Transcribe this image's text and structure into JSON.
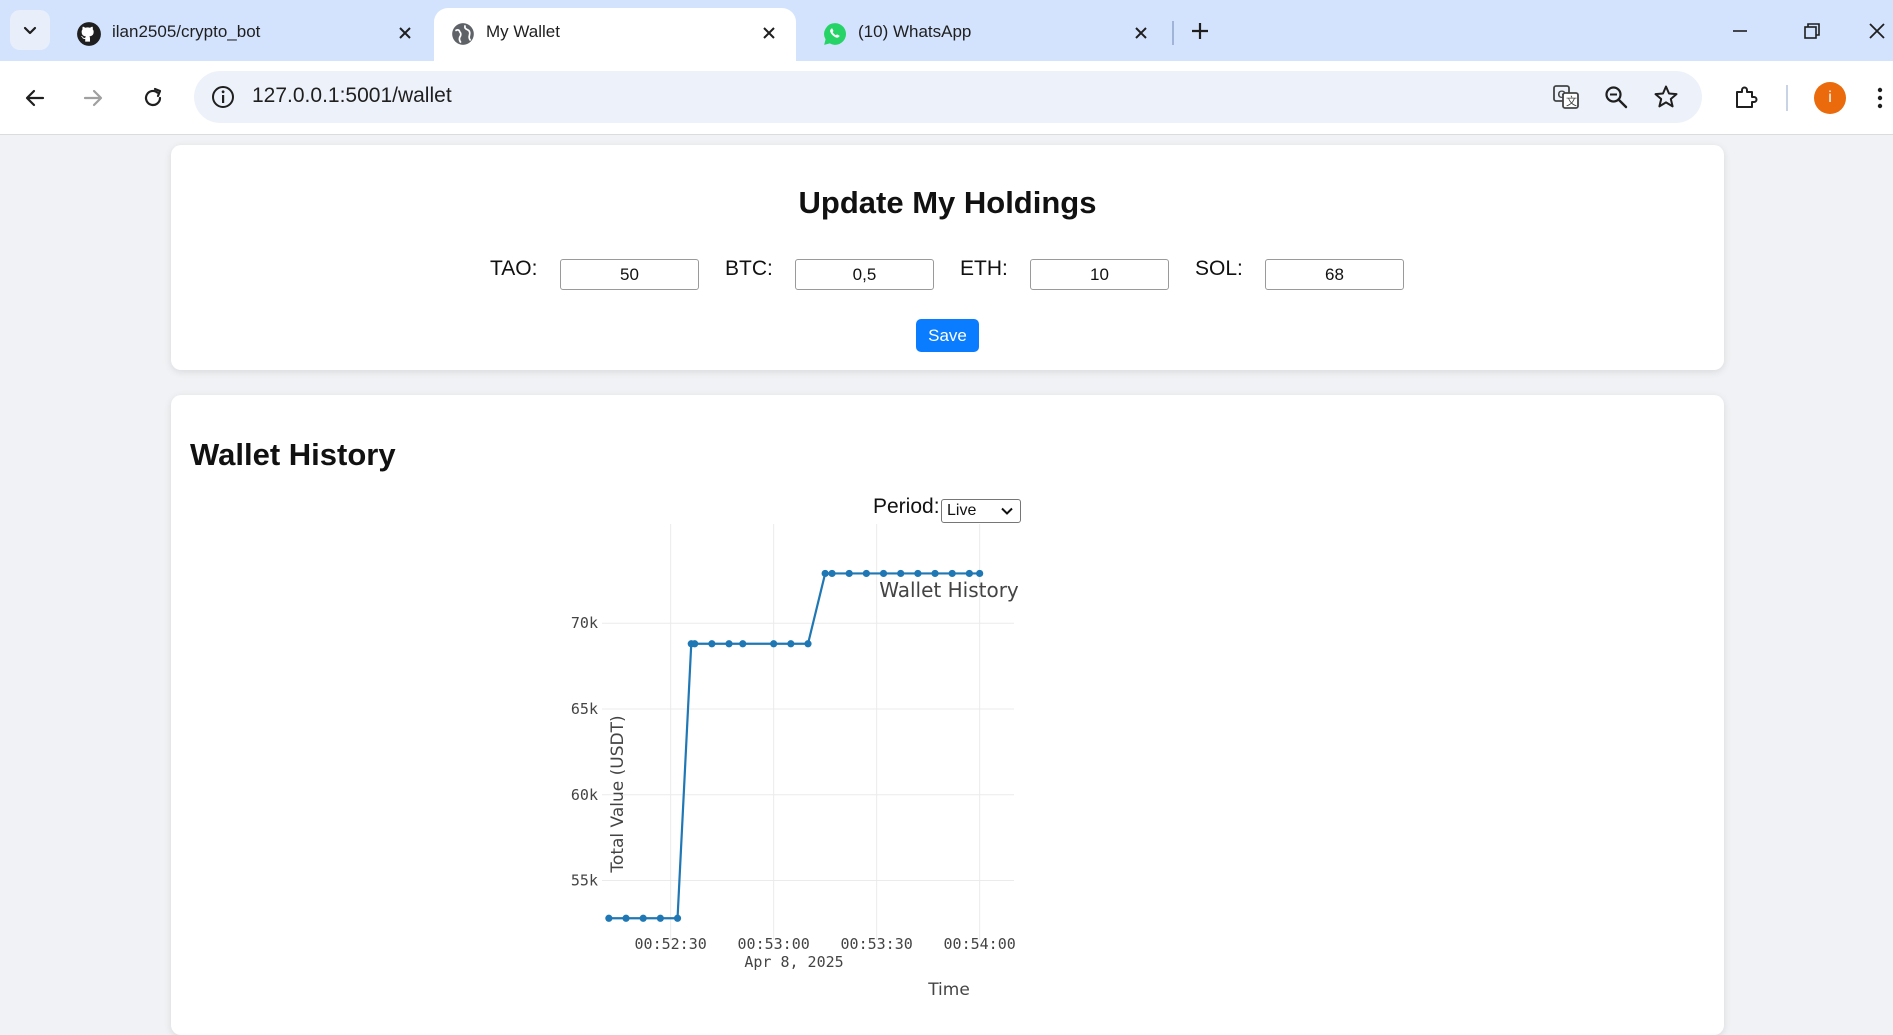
{
  "browser": {
    "tabs": [
      {
        "title": "ilan2505/crypto_bot",
        "icon": "github-icon",
        "active": false
      },
      {
        "title": "My Wallet",
        "icon": "globe-icon",
        "active": true
      },
      {
        "title": "(10) WhatsApp",
        "icon": "whatsapp-icon",
        "active": false
      }
    ],
    "url": "127.0.0.1:5001/wallet",
    "profile_initial": "i",
    "profile_color": "#ea6a0c"
  },
  "holdings": {
    "title": "Update My Holdings",
    "fields": [
      {
        "label": "TAO:",
        "value": "50"
      },
      {
        "label": "BTC:",
        "value": "0,5"
      },
      {
        "label": "ETH:",
        "value": "10"
      },
      {
        "label": "SOL:",
        "value": "68"
      }
    ],
    "save_label": "Save",
    "accent_color": "#0a7cff"
  },
  "history": {
    "title": "Wallet History",
    "period_label": "Period:",
    "period_value": "Live"
  },
  "chart_data": {
    "type": "line",
    "title": "Wallet History",
    "xlabel": "Time",
    "ylabel": "Total Value (USDT)",
    "x_ticks": [
      "00:52:30",
      "00:53:00",
      "00:53:30",
      "00:54:00"
    ],
    "x_tick_date": "Apr 8, 2025",
    "y_ticks": [
      "55k",
      "60k",
      "65k",
      "70k"
    ],
    "ylim": [
      52000,
      74500
    ],
    "xlim_seconds_from_00_52_00": [
      10,
      130
    ],
    "grid": true,
    "line_color": "#1f77b4",
    "series": [
      {
        "name": "",
        "x_time": [
          "00:52:12",
          "00:52:17",
          "00:52:22",
          "00:52:27",
          "00:52:32",
          "00:52:36",
          "00:52:37",
          "00:52:42",
          "00:52:47",
          "00:52:51",
          "00:53:00",
          "00:53:05",
          "00:53:10",
          "00:53:15",
          "00:53:17",
          "00:53:22",
          "00:53:27",
          "00:53:32",
          "00:53:37",
          "00:53:42",
          "00:53:47",
          "00:53:52",
          "00:53:57",
          "00:54:00"
        ],
        "values": [
          52800,
          52800,
          52800,
          52800,
          52800,
          68800,
          68800,
          68800,
          68800,
          68800,
          68800,
          68800,
          68800,
          72900,
          72900,
          72900,
          72900,
          72900,
          72900,
          72900,
          72900,
          72900,
          72900,
          72900
        ]
      }
    ]
  }
}
